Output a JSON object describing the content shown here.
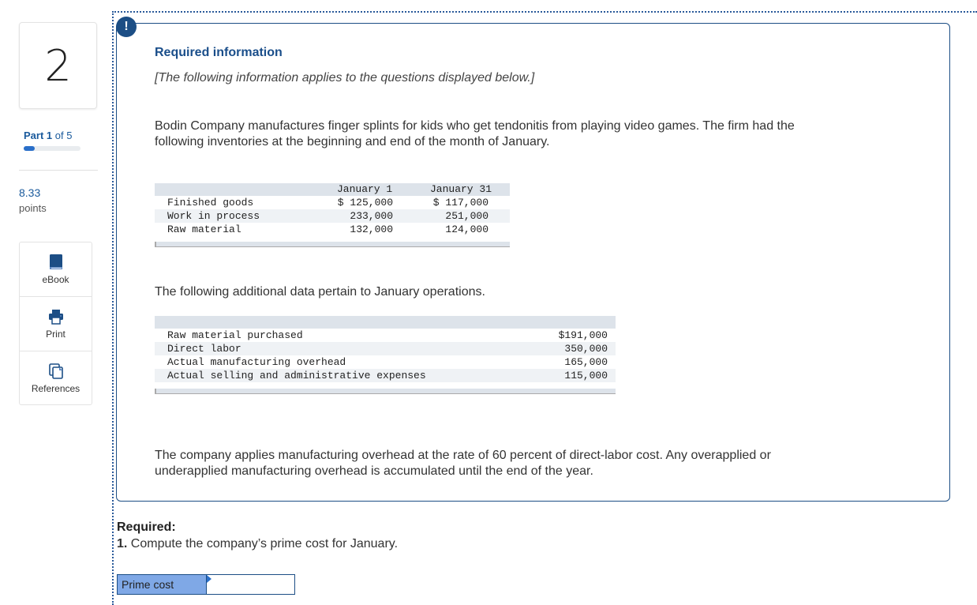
{
  "question": {
    "number": "2",
    "part_prefix": "Part",
    "part_current": "1",
    "part_of": "of 5",
    "progress_fraction": 0.2,
    "points_value": "8.33",
    "points_label": "points"
  },
  "tools": [
    {
      "label": "eBook",
      "icon": "book-icon"
    },
    {
      "label": "Print",
      "icon": "printer-icon"
    },
    {
      "label": "References",
      "icon": "references-icon"
    }
  ],
  "info": {
    "badge": "!",
    "title": "Required information",
    "note": "[The following information applies to the questions displayed below.]",
    "intro_line1": "Bodin Company manufactures finger splints for kids who get tendonitis from playing video games. The firm had the",
    "intro_line2": "following inventories at the beginning and end of the month of January.",
    "inventory_table": {
      "headers": [
        "",
        "January 1",
        "January 31"
      ],
      "rows": [
        [
          "Finished goods",
          "$ 125,000",
          "$ 117,000"
        ],
        [
          "Work in process",
          "233,000",
          "251,000"
        ],
        [
          "Raw material",
          "132,000",
          "124,000"
        ]
      ]
    },
    "additional_text": "The following additional data pertain to January operations.",
    "operations_table": {
      "rows": [
        [
          "Raw material purchased",
          "$191,000"
        ],
        [
          "Direct labor",
          "350,000"
        ],
        [
          "Actual manufacturing overhead",
          "165,000"
        ],
        [
          "Actual selling and administrative expenses",
          "115,000"
        ]
      ]
    },
    "closing_line1": "The company applies manufacturing overhead at the rate of 60 percent of direct-labor cost. Any overapplied or",
    "closing_line2": "underapplied manufacturing overhead is accumulated until the end of the year."
  },
  "required": {
    "heading": "Required:",
    "item_number": "1.",
    "item_text": "Compute the company’s prime cost for January.",
    "answer_label": "Prime cost",
    "answer_value": ""
  },
  "colors": {
    "accent": "#1c4e85",
    "answer_label_bg": "#7fa8e6",
    "table_header_bg": "#dde3ea"
  }
}
